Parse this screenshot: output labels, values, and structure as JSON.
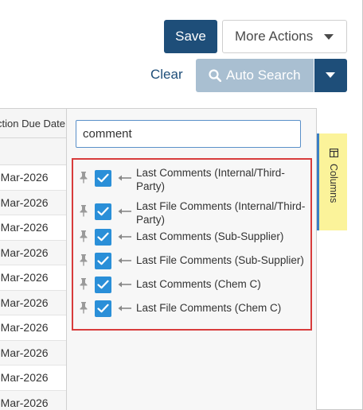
{
  "toolbar": {
    "save_label": "Save",
    "more_actions_label": "More Actions",
    "clear_label": "Clear",
    "auto_search_label": "Auto Search"
  },
  "grid": {
    "header": "ction Due Date",
    "rows": [
      "-Mar-2026",
      "-Mar-2026",
      "-Mar-2026",
      "-Mar-2026",
      "-Mar-2026",
      "-Mar-2026",
      "-Mar-2026",
      "-Mar-2026",
      "-Mar-2026",
      "-Mar-2026"
    ]
  },
  "column_panel": {
    "search_value": "comment",
    "items": [
      {
        "label": "Last Comments (Internal/Third-Party)",
        "checked": true
      },
      {
        "label": "Last File Comments (Internal/Third-Party)",
        "checked": true
      },
      {
        "label": "Last Comments (Sub-Supplier)",
        "checked": true
      },
      {
        "label": "Last File Comments (Sub-Supplier)",
        "checked": true
      },
      {
        "label": "Last Comments (Chem C)",
        "checked": true
      },
      {
        "label": "Last File Comments (Chem C)",
        "checked": true
      }
    ]
  },
  "side_tab": {
    "label": "Columns",
    "icon": "columns-icon"
  },
  "colors": {
    "primary": "#1e4e79",
    "disabled": "#a9bfd1",
    "checkbox": "#2a8fd8",
    "highlight_border": "#d83c3c",
    "tab_bg": "#fbf39a"
  }
}
